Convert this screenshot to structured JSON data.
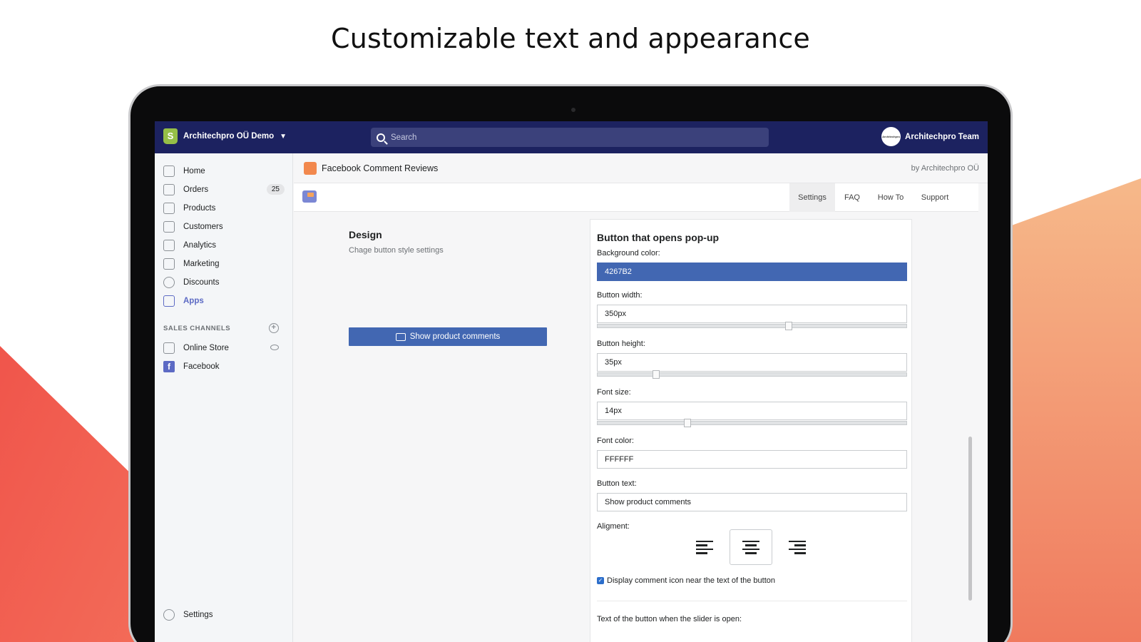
{
  "headline": "Customizable text and appearance",
  "topbar": {
    "store_name": "Architechpro OÜ Demo",
    "search_placeholder": "Search",
    "account_name": "Architechpro Team",
    "avatar_text": "Architechpro"
  },
  "sidebar": {
    "items": [
      {
        "label": "Home",
        "icon": "home-icon"
      },
      {
        "label": "Orders",
        "icon": "orders-icon",
        "badge": "25"
      },
      {
        "label": "Products",
        "icon": "tag-icon"
      },
      {
        "label": "Customers",
        "icon": "person-icon"
      },
      {
        "label": "Analytics",
        "icon": "bar-chart-icon"
      },
      {
        "label": "Marketing",
        "icon": "megaphone-icon"
      },
      {
        "label": "Discounts",
        "icon": "discount-icon"
      },
      {
        "label": "Apps",
        "icon": "apps-icon",
        "active": true
      }
    ],
    "sales_channels_heading": "SALES CHANNELS",
    "channels": [
      {
        "label": "Online Store",
        "icon": "store-icon"
      },
      {
        "label": "Facebook",
        "icon": "facebook-icon"
      }
    ],
    "settings_label": "Settings"
  },
  "app": {
    "title": "Facebook Comment Reviews",
    "by": "by Architechpro OÜ",
    "tabs": [
      "Settings",
      "FAQ",
      "How To",
      "Support"
    ],
    "selected_tab": "Settings"
  },
  "design": {
    "title": "Design",
    "subtitle": "Chage button style settings",
    "preview_button_text": "Show product comments"
  },
  "form": {
    "title": "Button that opens pop-up",
    "background_color_label": "Background color:",
    "background_color_value": "4267B2",
    "background_color_hex": "#4267B2",
    "button_width_label": "Button width:",
    "button_width_value": "350px",
    "button_width_slider_fraction": 0.62,
    "button_height_label": "Button height:",
    "button_height_value": "35px",
    "button_height_slider_fraction": 0.19,
    "font_size_label": "Font size:",
    "font_size_value": "14px",
    "font_size_slider_fraction": 0.29,
    "font_color_label": "Font color:",
    "font_color_value": "FFFFFF",
    "button_text_label": "Button text:",
    "button_text_value": "Show product comments",
    "alignment_label": "Aligment:",
    "alignment_options": [
      "left",
      "center",
      "right"
    ],
    "alignment_selected": "center",
    "display_icon_label": "Display comment icon near the text of the button",
    "display_icon_checked": true,
    "slider_open_label": "Text of the button when the slider is open:"
  }
}
